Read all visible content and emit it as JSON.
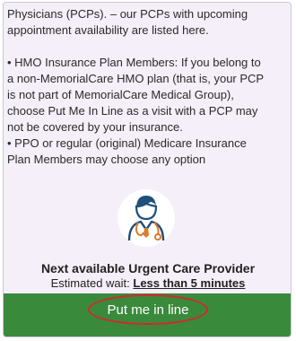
{
  "info": {
    "lines": [
      "Physicians (PCPs). – our PCPs with upcoming",
      "appointment availability are listed here.",
      "",
      "• HMO Insurance Plan Members: If you belong to",
      "a non-MemorialCare HMO plan (that is, your PCP",
      "is not part of MemorialCare Medical Group),",
      "choose Put Me In Line as a visit with a PCP may",
      "not be covered by your insurance.",
      "• PPO or regular (original) Medicare Insurance",
      "Plan Members may choose any option"
    ]
  },
  "provider": {
    "icon": "doctor-avatar-icon",
    "title": "Next available Urgent Care Provider",
    "wait_prefix": "Estimated wait: ",
    "wait_value": "Less than 5 minutes"
  },
  "cta": {
    "label": "Put me in line"
  },
  "colors": {
    "accent_green": "#3a8a3c",
    "avatar_orange": "#e07a2a",
    "avatar_blue": "#1f4f7a",
    "highlight_red": "#d8262b",
    "panel_bg": "#f4eff8"
  }
}
